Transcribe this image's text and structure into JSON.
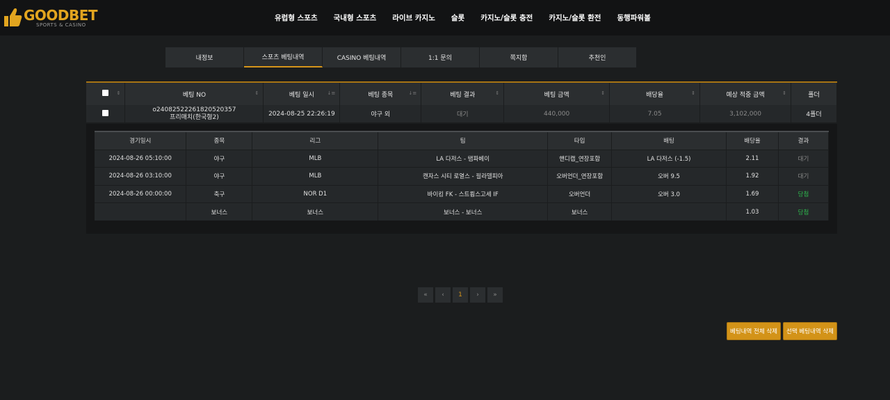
{
  "header": {
    "brand": "GOODBET",
    "tagline": "SPORTS & CASINO",
    "nav": [
      "유럽형 스포츠",
      "국내형 스포츠",
      "라이브 카지노",
      "슬롯",
      "카지노/슬롯 충전",
      "카지노/슬롯 환전",
      "동행파워볼"
    ]
  },
  "tabs": [
    "내정보",
    "스포츠 베팅내역",
    "CASINO 베팅내역",
    "1:1 문의",
    "쪽지함",
    "추천인"
  ],
  "active_tab": "스포츠 베팅내역",
  "bet_table": {
    "headers": [
      "베팅 NO",
      "베팅 일시",
      "베팅 종목",
      "베팅 결과",
      "베팅 금액",
      "배당율",
      "예상 적중 금액",
      "폴더"
    ],
    "row": {
      "bet_no": "o24082522261820520357",
      "bet_type": "프리매치(한국형2)",
      "date": "2024-08-25 22:26:19",
      "sport": "야구 외",
      "result": "대기",
      "amount": "440,000",
      "odds": "7.05",
      "expected": "3,102,000",
      "folder": "4폴더"
    }
  },
  "detail_table": {
    "headers": [
      "경기일시",
      "종목",
      "리그",
      "팀",
      "타입",
      "배팅",
      "배당율",
      "결과"
    ],
    "rows": [
      {
        "date": "2024-08-26 05:10:00",
        "sport": "야구",
        "league": "MLB",
        "team": "LA 다저스 - 탬파베이",
        "type": "핸디캡_연장포함",
        "pick": "LA 다저스 (-1.5)",
        "odds": "2.11",
        "result": "대기"
      },
      {
        "date": "2024-08-26 03:10:00",
        "sport": "야구",
        "league": "MLB",
        "team": "캔자스 시티 로열스 - 필라델피아",
        "type": "오버언더_연장포함",
        "pick": "오버 9.5",
        "odds": "1.92",
        "result": "대기"
      },
      {
        "date": "2024-08-26 00:00:00",
        "sport": "축구",
        "league": "NOR D1",
        "team": "바이킹 FK - 스트룀스고세 IF",
        "type": "오버언더",
        "pick": "오버 3.0",
        "odds": "1.69",
        "result": "당첨"
      },
      {
        "date": "",
        "sport": "보너스",
        "league": "보너스",
        "team": "보너스 - 보너스",
        "type": "보너스",
        "pick": "",
        "odds": "1.03",
        "result": "당첨"
      }
    ]
  },
  "pagination": {
    "first": "«",
    "prev": "‹",
    "current": "1",
    "next": "›",
    "last": "»"
  },
  "buttons": {
    "delete_all": "베팅내역 전체 삭제",
    "delete_selected": "선택 베팅내역 삭제"
  },
  "colors": {
    "accent": "#d6951a",
    "win": "#2db84d",
    "pending": "#8a8a8a"
  }
}
